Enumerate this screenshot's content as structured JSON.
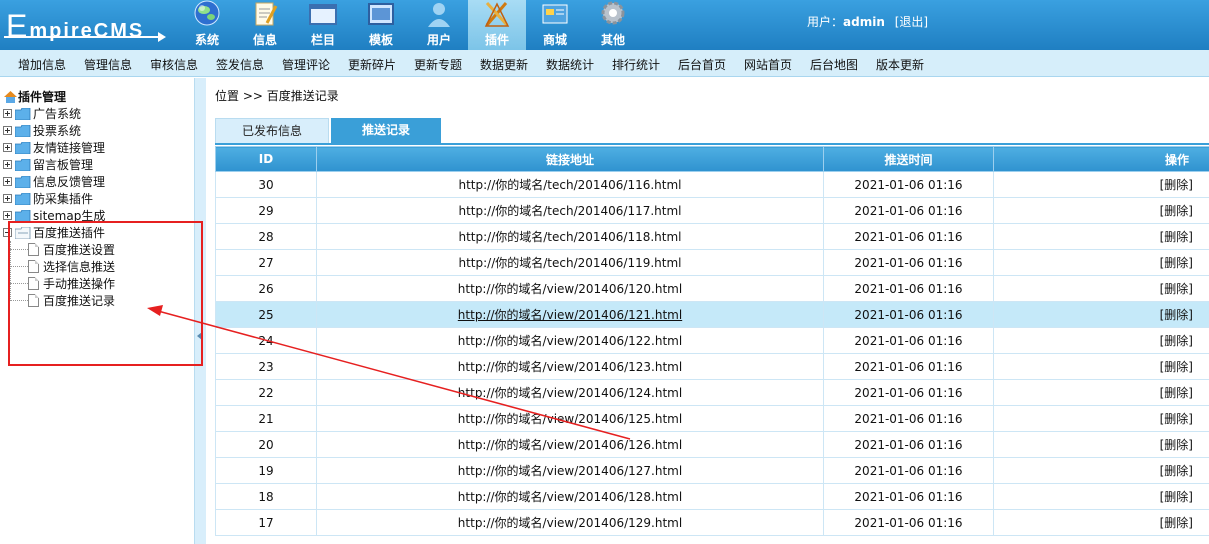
{
  "header": {
    "logo_prefix": "E",
    "logo_rest": "mpireCMS",
    "nav": [
      {
        "label": "系统",
        "icon": "globe-icon"
      },
      {
        "label": "信息",
        "icon": "notepad-icon"
      },
      {
        "label": "栏目",
        "icon": "window-icon"
      },
      {
        "label": "模板",
        "icon": "template-icon"
      },
      {
        "label": "用户",
        "icon": "user-icon"
      },
      {
        "label": "插件",
        "icon": "tools-icon",
        "active": true
      },
      {
        "label": "商城",
        "icon": "shop-icon"
      },
      {
        "label": "其他",
        "icon": "gear-icon"
      }
    ],
    "user_label": "用户：",
    "user_name": "admin",
    "logout": "[退出]"
  },
  "toolbar": [
    "增加信息",
    "管理信息",
    "审核信息",
    "签发信息",
    "管理评论",
    "更新碎片",
    "更新专题",
    "数据更新",
    "数据统计",
    "排行统计",
    "后台首页",
    "网站首页",
    "后台地图",
    "版本更新"
  ],
  "tree": {
    "root": "插件管理",
    "items": [
      "广告系统",
      "投票系统",
      "友情链接管理",
      "留言板管理",
      "信息反馈管理",
      "防采集插件",
      "sitemap生成",
      "百度推送插件"
    ],
    "children": [
      "百度推送设置",
      "选择信息推送",
      "手动推送操作",
      "百度推送记录"
    ]
  },
  "breadcrumb": "位置 >> 百度推送记录",
  "tabs": [
    "已发布信息",
    "推送记录"
  ],
  "table": {
    "headers": [
      "ID",
      "链接地址",
      "推送时间",
      "操作"
    ],
    "rows": [
      {
        "id": "30",
        "url": "http://你的域名/tech/201406/116.html",
        "time": "2021-01-06 01:16",
        "op": "[删除]"
      },
      {
        "id": "29",
        "url": "http://你的域名/tech/201406/117.html",
        "time": "2021-01-06 01:16",
        "op": "[删除]"
      },
      {
        "id": "28",
        "url": "http://你的域名/tech/201406/118.html",
        "time": "2021-01-06 01:16",
        "op": "[删除]"
      },
      {
        "id": "27",
        "url": "http://你的域名/tech/201406/119.html",
        "time": "2021-01-06 01:16",
        "op": "[删除]"
      },
      {
        "id": "26",
        "url": "http://你的域名/view/201406/120.html",
        "time": "2021-01-06 01:16",
        "op": "[删除]"
      },
      {
        "id": "25",
        "url": "http://你的域名/view/201406/121.html",
        "time": "2021-01-06 01:16",
        "op": "[删除]"
      },
      {
        "id": "24",
        "url": "http://你的域名/view/201406/122.html",
        "time": "2021-01-06 01:16",
        "op": "[删除]"
      },
      {
        "id": "23",
        "url": "http://你的域名/view/201406/123.html",
        "time": "2021-01-06 01:16",
        "op": "[删除]"
      },
      {
        "id": "22",
        "url": "http://你的域名/view/201406/124.html",
        "time": "2021-01-06 01:16",
        "op": "[删除]"
      },
      {
        "id": "21",
        "url": "http://你的域名/view/201406/125.html",
        "time": "2021-01-06 01:16",
        "op": "[删除]"
      },
      {
        "id": "20",
        "url": "http://你的域名/view/201406/126.html",
        "time": "2021-01-06 01:16",
        "op": "[删除]"
      },
      {
        "id": "19",
        "url": "http://你的域名/view/201406/127.html",
        "time": "2021-01-06 01:16",
        "op": "[删除]"
      },
      {
        "id": "18",
        "url": "http://你的域名/view/201406/128.html",
        "time": "2021-01-06 01:16",
        "op": "[删除]"
      },
      {
        "id": "17",
        "url": "http://你的域名/view/201406/129.html",
        "time": "2021-01-06 01:16",
        "op": "[删除]"
      }
    ]
  },
  "colors": {
    "header_blue": "#2a8ccf",
    "toolbar_bg": "#d6eefa",
    "table_header": "#3a9fd8",
    "highlight_row": "#c5e9f9",
    "annotation_red": "#e62020"
  }
}
